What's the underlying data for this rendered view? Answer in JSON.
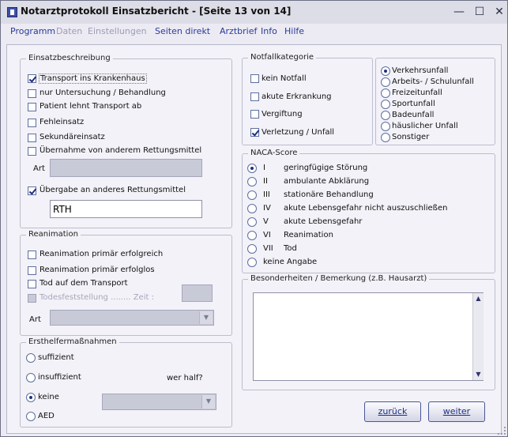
{
  "window": {
    "title": "Notarztprotokoll Einsatzbericht - [Seite 13 von 14]",
    "minimize": "—",
    "maximize": "☐",
    "close": "✕"
  },
  "menu": {
    "programm": "Programm",
    "daten": "Daten",
    "einstellungen": "Einstellungen",
    "seiten_direkt": "Seiten direkt",
    "arztbrief": "Arztbrief",
    "info": "Info",
    "hilfe": "Hilfe"
  },
  "einsatz": {
    "title": "Einsatzbeschreibung",
    "transport": "Transport ins Krankenhaus",
    "untersuchung": "nur Untersuchung / Behandlung",
    "lehnt_ab": "Patient lehnt Transport ab",
    "fehleinsatz": "Fehleinsatz",
    "sekundaer": "Sekundäreinsatz",
    "uebernahme": "Übernahme von anderem Rettungsmittel",
    "art_label": "Art",
    "art_value": "",
    "uebergabe": "Übergabe an anderes Rettungsmittel",
    "uebergabe_value": "RTH"
  },
  "reanimation": {
    "title": "Reanimation",
    "erfolgreich": "Reanimation primär erfolgreich",
    "erfolglos": "Reanimation primär erfolglos",
    "tod_transport": "Tod auf dem Transport",
    "todesfeststellung": "Todesfeststellung ........ Zeit :",
    "art_label": "Art"
  },
  "ersthelfer": {
    "title": "Ersthelfermaßnahmen",
    "suffizient": "suffizient",
    "insuffizient": "insuffizient",
    "keine": "keine",
    "aed": "AED",
    "wer_half": "wer half?"
  },
  "notfall": {
    "title": "Notfallkategorie",
    "kein_notfall": "kein Notfall",
    "akute_erkrankung": "akute Erkrankung",
    "vergiftung": "Vergiftung",
    "verletzung": "Verletzung / Unfall",
    "unfall_types": [
      "Verkehrsunfall",
      "Arbeits- / Schulunfall",
      "Freizeitunfall",
      "Sportunfall",
      "Badeunfall",
      "häuslicher Unfall",
      "Sonstiger"
    ]
  },
  "naca": {
    "title": "NACA-Score",
    "items": [
      {
        "num": "I",
        "text": "geringfügige Störung"
      },
      {
        "num": "II",
        "text": "ambulante Abklärung"
      },
      {
        "num": "III",
        "text": "stationäre Behandlung"
      },
      {
        "num": "IV",
        "text": "akute Lebensgefahr nicht auszuschließen"
      },
      {
        "num": "V",
        "text": "akute Lebensgefahr"
      },
      {
        "num": "VI",
        "text": "Reanimation"
      },
      {
        "num": "VII",
        "text": "Tod"
      }
    ],
    "keine_angabe": "keine Angabe"
  },
  "bemerkung": {
    "title": "Besonderheiten / Bemerkung  (z.B. Hausarzt)",
    "value": ""
  },
  "buttons": {
    "zurueck": "zurück",
    "weiter": "weiter"
  }
}
